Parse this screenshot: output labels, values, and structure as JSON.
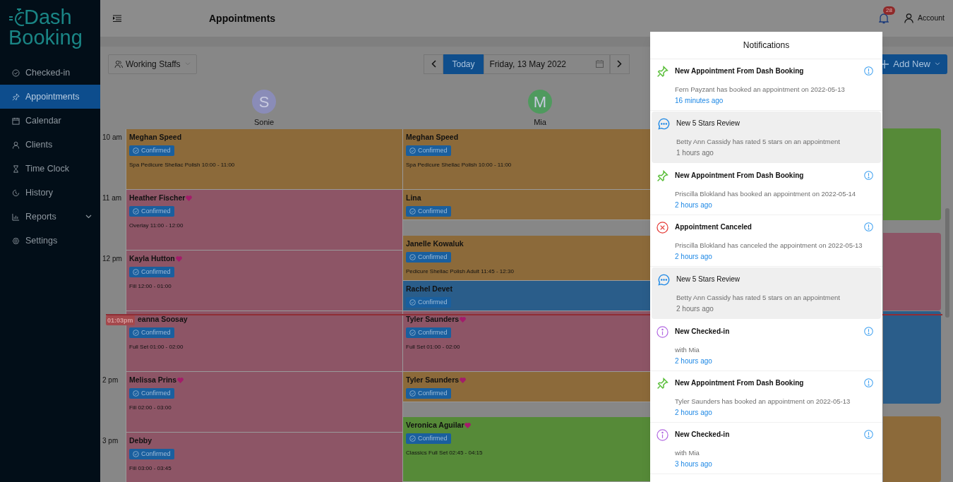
{
  "sidebar": {
    "logo": {
      "line_1": "Dash",
      "line_2": "Booking"
    },
    "items": [
      {
        "label": "Checked-in",
        "selected": false,
        "has_submenu": false
      },
      {
        "label": "Appointments",
        "selected": true,
        "has_submenu": false
      },
      {
        "label": "Calendar",
        "selected": false,
        "has_submenu": false
      },
      {
        "label": "Clients",
        "selected": false,
        "has_submenu": false
      },
      {
        "label": "Time Clock",
        "selected": false,
        "has_submenu": false
      },
      {
        "label": "History",
        "selected": false,
        "has_submenu": false
      },
      {
        "label": "Reports",
        "selected": false,
        "has_submenu": true
      },
      {
        "label": "Settings",
        "selected": false,
        "has_submenu": false
      }
    ]
  },
  "header": {
    "title": "Appointments",
    "notification_count": "28",
    "account": "Account"
  },
  "toolbar": {
    "staff_filter": "Working Staffs",
    "today": "Today",
    "date": "Friday, 13 May 2022",
    "add_new": "Add New"
  },
  "staff": [
    {
      "name": "Sonie",
      "initial": "S",
      "color": "#8a8cb8"
    },
    {
      "name": "Mia",
      "initial": "M",
      "color": "#4f9a5e"
    }
  ],
  "times": [
    "10 am",
    "11 am",
    "12 pm",
    "2 pm",
    "3 pm"
  ],
  "now_marker": "01:03pm",
  "columns": [
    {
      "events": [
        {
          "client": "Meghan Speed",
          "favorite": false,
          "status": "Confirmed",
          "service": "Spa Pedicure Shellac Polish 10:00 - 11:00",
          "color": "#8c6a3a"
        },
        {
          "client": "Heather Fischer",
          "favorite": true,
          "status": "Confirmed",
          "service": "Overlay 11:00 - 12:00",
          "color": "#8d5566"
        },
        {
          "client": "Kayla Hutton",
          "favorite": true,
          "status": "Confirmed",
          "service": "Fill 12:00 - 01:00",
          "color": "#8d5566"
        },
        {
          "client": "eanna Soosay",
          "favorite": false,
          "status": "Confirmed",
          "service": "Full Set 01:00 - 02:00",
          "color": "#8d5566"
        },
        {
          "client": "Melissa Prins",
          "favorite": true,
          "status": "Confirmed",
          "service": "Fill 02:00 - 03:00",
          "color": "#8d5566"
        },
        {
          "client": "Debby",
          "favorite": false,
          "status": "Confirmed",
          "service": "Fill 03:00 - 03:45",
          "color": "#8d5566"
        }
      ]
    },
    {
      "events": [
        {
          "client": "Meghan Speed",
          "favorite": false,
          "status": "Confirmed",
          "service": "Spa Pedicure Shellac Polish 10:00 - 11:00",
          "color": "#8c6a3a"
        },
        {
          "client": "Lina",
          "favorite": false,
          "status": "Confirmed",
          "color": "#8c6a3a"
        },
        {
          "client": "Janelle Kowaluk",
          "favorite": false,
          "status": "Confirmed",
          "service": "Pedicure Shellac Polish Adult 11:45 - 12:30",
          "color": "#8c6a3a"
        },
        {
          "client": "Rachel Devet",
          "favorite": false,
          "status": "Confirmed",
          "color": "#2a5d8a"
        },
        {
          "client": "Tyler Saunders",
          "favorite": true,
          "status": "Confirmed",
          "service": "Full Set 01:00 - 02:00",
          "color": "#8d5566"
        },
        {
          "client": "Tyler Saunders",
          "favorite": true,
          "status": "Confirmed",
          "color": "#8c6a3a"
        },
        {
          "client": "Veronica Aguilar",
          "favorite": true,
          "status": "Confirmed",
          "service": "Classics Full Set 02:45 - 04:15",
          "color": "#568a38"
        }
      ]
    },
    {
      "events": [
        {
          "color": "#568a38"
        },
        {
          "color": "#8d5566"
        },
        {
          "color": "#2a5d8a"
        },
        {
          "color": "#8c6a3a"
        }
      ]
    }
  ],
  "notifications": {
    "title": "Notifications",
    "items": [
      {
        "kind": "appointment",
        "highlighted": false,
        "title": "New Appointment From Dash Booking",
        "body": "Fern Payzant has booked an appointment on 2022-05-13",
        "time": "16 minutes ago"
      },
      {
        "kind": "review",
        "highlighted": true,
        "title": "New 5 Stars Review",
        "body": "Betty Ann Cassidy has rated 5 stars on an appointment",
        "time": "1 hours ago"
      },
      {
        "kind": "appointment",
        "highlighted": false,
        "title": "New Appointment From Dash Booking",
        "body": "Priscilla Blokland has booked an appointment on 2022-05-14",
        "time": "2 hours ago"
      },
      {
        "kind": "canceled",
        "highlighted": false,
        "title": "Appointment Canceled",
        "body": "Priscilla Blokland has canceled the appointment on 2022-05-13",
        "time": "2 hours ago"
      },
      {
        "kind": "review",
        "highlighted": true,
        "title": "New 5 Stars Review",
        "body": "Betty Ann Cassidy has rated 5 stars on an appointment",
        "time": "2 hours ago"
      },
      {
        "kind": "checkin",
        "highlighted": false,
        "title": "New Checked-in",
        "body": "with Mia",
        "time": "2 hours ago"
      },
      {
        "kind": "appointment",
        "highlighted": false,
        "title": "New Appointment From Dash Booking",
        "body": "Tyler Saunders has booked an appointment on 2022-05-13",
        "time": "2 hours ago"
      },
      {
        "kind": "checkin",
        "highlighted": false,
        "title": "New Checked-in",
        "body": "with Mia",
        "time": "3 hours ago"
      }
    ]
  }
}
